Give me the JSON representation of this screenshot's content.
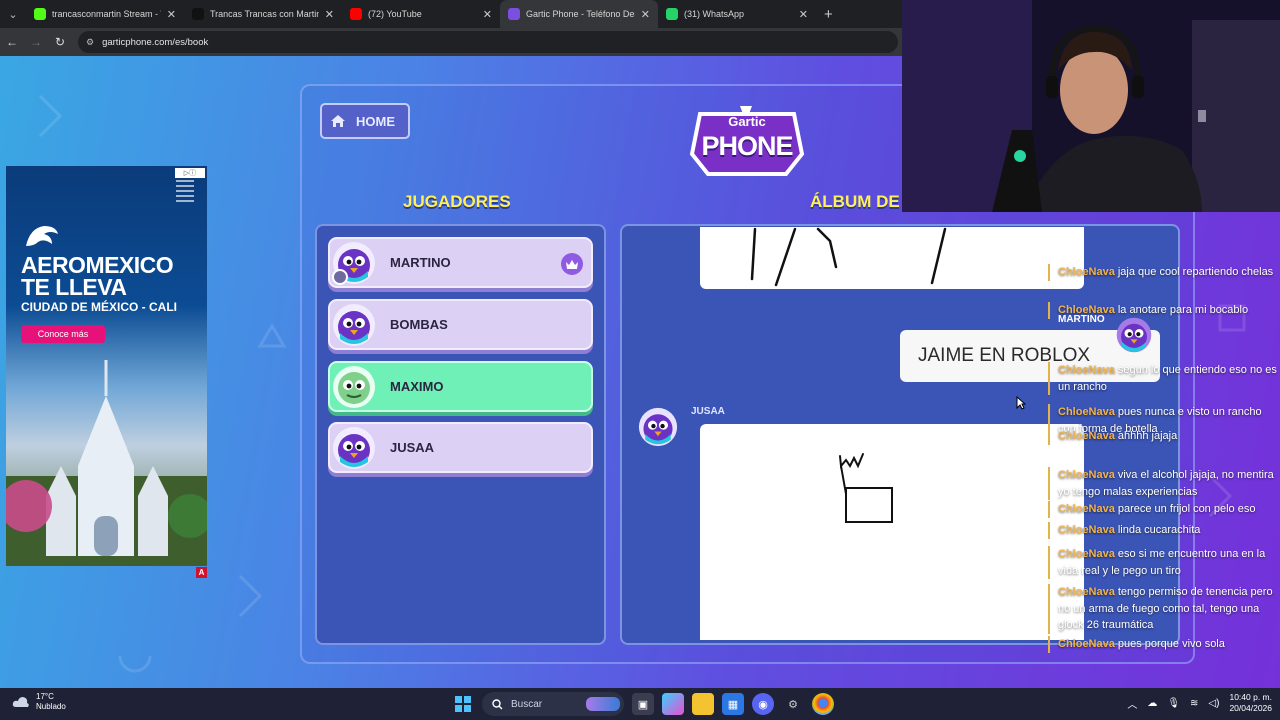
{
  "browser": {
    "tabs": [
      {
        "title": "trancasconmartin Stream - Wat",
        "favicon": "kick-icon",
        "color": "#53fc18",
        "active": false
      },
      {
        "title": "Trancas Trancas con Martin (@",
        "favicon": "tiktok-icon",
        "color": "#111111",
        "active": false
      },
      {
        "title": "(72) YouTube",
        "favicon": "youtube-icon",
        "color": "#ff0000",
        "active": false
      },
      {
        "title": "Gartic Phone - Teléfono Descor",
        "favicon": "gartic-icon",
        "color": "#7b4fe0",
        "active": true
      },
      {
        "title": "(31) WhatsApp",
        "favicon": "whatsapp-icon",
        "color": "#25d366",
        "active": false
      }
    ],
    "url": "garticphone.com/es/book"
  },
  "game": {
    "home_label": "HOME",
    "logo_top": "Gartic",
    "logo_bottom": "PHONE",
    "players_title": "JUGADORES",
    "album_title": "ÁLBUM DE",
    "players": [
      {
        "name": "MARTINO",
        "host": true,
        "highlight": false
      },
      {
        "name": "BOMBAS",
        "host": false,
        "highlight": false
      },
      {
        "name": "MAXIMO",
        "host": false,
        "highlight": true
      },
      {
        "name": "JUSAA",
        "host": false,
        "highlight": false
      }
    ],
    "album": {
      "answer_author": "MARTINO",
      "answer_text": "JAIME EN ROBLOX",
      "drawing_author": "JUSAA"
    }
  },
  "ad": {
    "brand": "AEROMEXICO TE LLEVA",
    "route": "CIUDAD DE MÉXICO - CALI",
    "cta": "Conoce más",
    "badge": "▷ⓘ",
    "corner": "A"
  },
  "chat": [
    {
      "user": "ChloeNava",
      "text": "jaja que cool repartiendo chelas"
    },
    {
      "user": "ChloeNava",
      "text": "la anotare para mi bocablo"
    },
    {
      "user": "ChloeNava",
      "text": "segun lo que entiendo eso no es un rancho"
    },
    {
      "user": "ChloeNava",
      "text": "pues nunca e visto un rancho con forma de botella"
    },
    {
      "user": "ChloeNava",
      "text": "ahhhh jajaja"
    },
    {
      "user": "ChloeNava",
      "text": "viva el alcohol jajaja, no mentira yo tengo malas experiencias"
    },
    {
      "user": "ChloeNava",
      "text": "parece un frijol con pelo eso"
    },
    {
      "user": "ChloeNava",
      "text": "linda cucarachita"
    },
    {
      "user": "ChloeNava",
      "text": "eso si me encuentro una en la vida real y le pego un tiro"
    },
    {
      "user": "ChloeNava",
      "text": "tengo permiso de tenencia pero no un arma de fuego como tal, tengo una glock 26 traumática"
    },
    {
      "user": "ChloeNava",
      "text": "pues porque vivo sola"
    }
  ],
  "taskbar": {
    "temperature": "17°C",
    "weather": "Nublado",
    "search_placeholder": "Buscar",
    "time": "10:40 p. m.",
    "date": "20/04/2026"
  }
}
